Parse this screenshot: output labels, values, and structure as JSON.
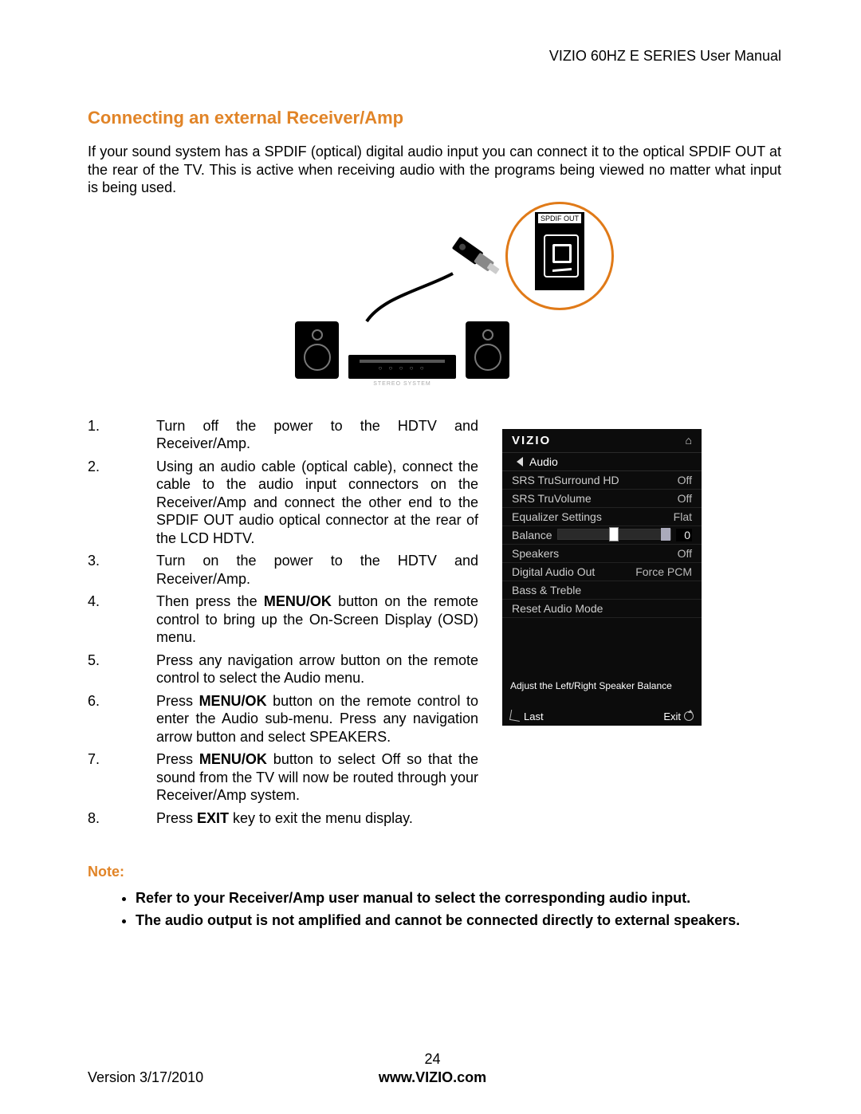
{
  "header": {
    "title": "VIZIO 60HZ E SERIES User Manual"
  },
  "section": {
    "title": "Connecting an external Receiver/Amp",
    "intro": "If your sound system has a SPDIF (optical) digital audio input you can connect it to the optical SPDIF OUT at the rear of the TV.  This is active when receiving audio with the programs being viewed no matter what input is being used."
  },
  "illustration": {
    "port_label": "SPDIF OUT",
    "stereo_label": "STEREO SYSTEM"
  },
  "steps": [
    "Turn off the power to the HDTV and Receiver/Amp.",
    "Using an audio cable (optical cable), connect the cable to the audio input connectors on the Receiver/Amp and connect the other end to the SPDIF OUT  audio optical connector at the rear of the LCD HDTV.",
    "Turn on the power to the HDTV and Receiver/Amp.",
    "Then press the <b>MENU/OK</b> button on the remote control to bring up the On-Screen Display (OSD) menu.",
    "Press any navigation arrow button on the remote control to select the Audio menu.",
    "Press <b>MENU/OK</b> button on the remote control to enter the Audio sub-menu. Press any navigation arrow button and select SPEAKERS.",
    "Press <b>MENU/OK</b> button to select Off so that the sound from the TV will now be routed through your Receiver/Amp system.",
    "Press <b>EXIT</b> key to exit the menu display."
  ],
  "osd": {
    "logo": "VIZIO",
    "menu": "Audio",
    "rows": {
      "srs_ts_label": "SRS TruSurround HD",
      "srs_ts_val": "Off",
      "srs_tv_label": "SRS TruVolume",
      "srs_tv_val": "Off",
      "eq_label": "Equalizer Settings",
      "eq_val": "Flat",
      "bal_label": "Balance",
      "bal_val": "0",
      "spk_label": "Speakers",
      "spk_val": "Off",
      "dao_label": "Digital Audio Out",
      "dao_val": "Force PCM",
      "bt_label": "Bass & Treble",
      "ram_label": "Reset Audio Mode"
    },
    "help": "Adjust the Left/Right Speaker Balance",
    "last": "Last",
    "exit": "Exit"
  },
  "note": {
    "heading": "Note:",
    "items": [
      "Refer to your Receiver/Amp user manual to select the corresponding audio input.",
      "The audio output is not amplified and cannot be connected directly to external speakers."
    ]
  },
  "footer": {
    "page": "24",
    "version": "Version 3/17/2010",
    "url": "www.VIZIO.com"
  }
}
